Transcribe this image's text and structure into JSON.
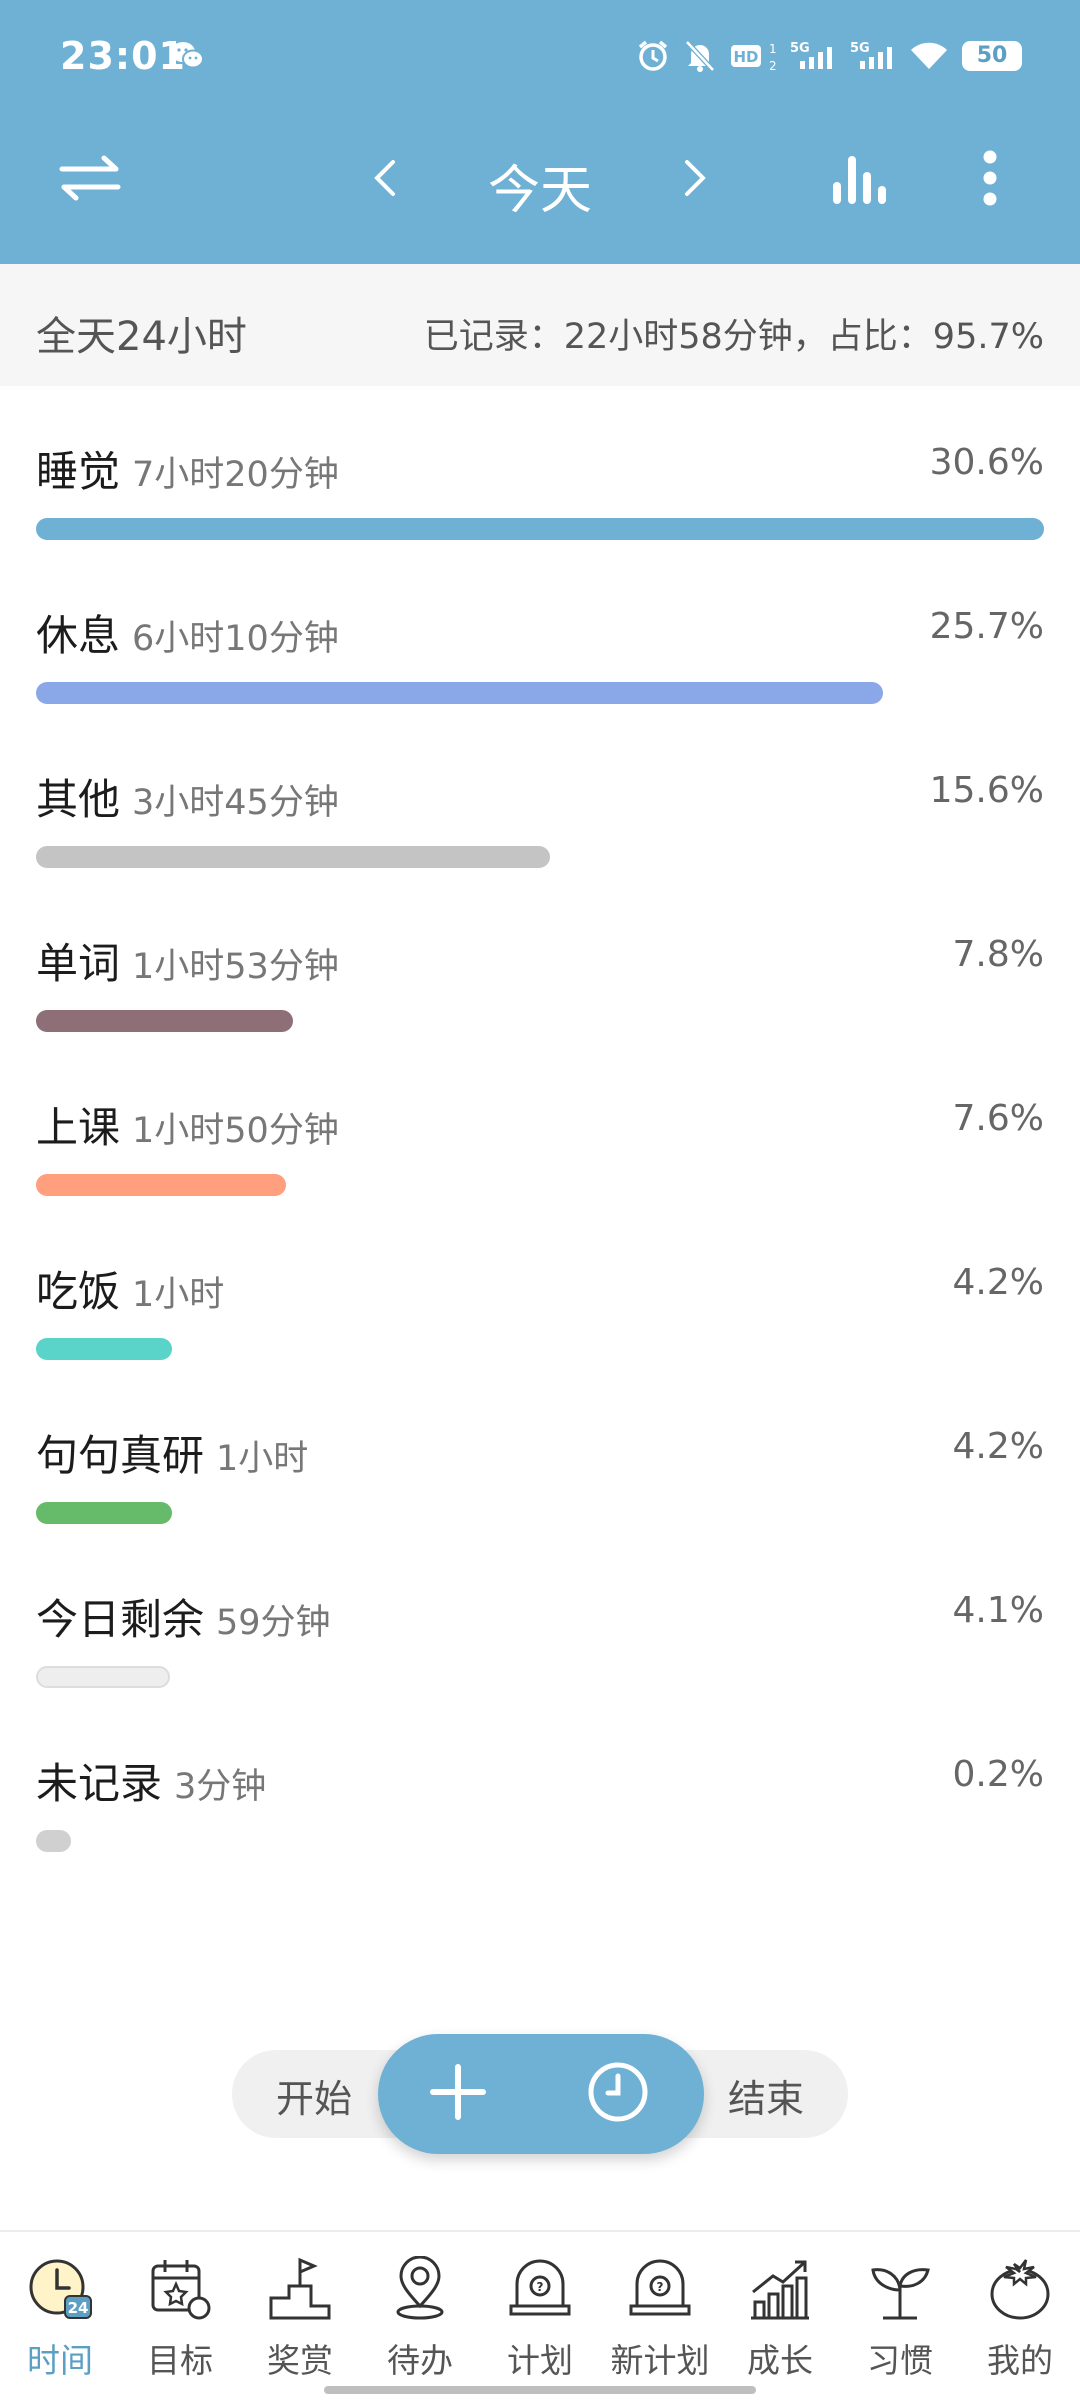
{
  "status_bar": {
    "time": "23:01",
    "icons": [
      "wechat-icon",
      "alarm-icon",
      "bell-off-icon",
      "hd-icon",
      "signal-5g-icon",
      "signal-5g-icon",
      "wifi-icon"
    ],
    "battery": "50"
  },
  "header": {
    "title": "今天",
    "accent_color": "#6fb1d4",
    "icons": [
      "swap-icon",
      "chevron-left-icon",
      "chevron-right-icon",
      "bar-chart-icon",
      "more-vertical-icon"
    ]
  },
  "summary": {
    "total": "全天24小时",
    "recorded": "已记录：22小时58分钟，占比：95.7%"
  },
  "items": [
    {
      "name": "睡觉",
      "duration": "7小时20分钟",
      "percent": "30.6%",
      "fraction": 1.0,
      "color": "#6fb1d4"
    },
    {
      "name": "休息",
      "duration": "6小时10分钟",
      "percent": "25.7%",
      "fraction": 0.84,
      "color": "#8aa8e8"
    },
    {
      "name": "其他",
      "duration": "3小时45分钟",
      "percent": "15.6%",
      "fraction": 0.51,
      "color": "#c4c4c4"
    },
    {
      "name": "单词",
      "duration": "1小时53分钟",
      "percent": "7.8%",
      "fraction": 0.255,
      "color": "#8e6f78"
    },
    {
      "name": "上课",
      "duration": "1小时50分钟",
      "percent": "7.6%",
      "fraction": 0.248,
      "color": "#ff9f7d"
    },
    {
      "name": "吃饭",
      "duration": "1小时",
      "percent": "4.2%",
      "fraction": 0.135,
      "color": "#5ad3c8"
    },
    {
      "name": "句句真研",
      "duration": "1小时",
      "percent": "4.2%",
      "fraction": 0.135,
      "color": "#66bb6a"
    },
    {
      "name": "今日剩余",
      "duration": "59分钟",
      "percent": "4.1%",
      "fraction": 0.133,
      "color": "#eeeeee"
    },
    {
      "name": "未记录",
      "duration": "3分钟",
      "percent": "0.2%",
      "fraction": 0.035,
      "color": "#d0d0d0"
    }
  ],
  "control": {
    "start_label": "开始",
    "end_label": "结束",
    "icons": [
      "plus-icon",
      "clock-icon"
    ]
  },
  "nav": [
    {
      "label": "时间",
      "icon": "clock-24-icon",
      "active": true
    },
    {
      "label": "目标",
      "icon": "calendar-star-icon",
      "active": false
    },
    {
      "label": "奖赏",
      "icon": "podium-flag-icon",
      "active": false
    },
    {
      "label": "待办",
      "icon": "location-pin-icon",
      "active": false
    },
    {
      "label": "计划",
      "icon": "brain-icon",
      "active": false
    },
    {
      "label": "新计划",
      "icon": "brain-icon",
      "active": false
    },
    {
      "label": "成长",
      "icon": "growth-chart-icon",
      "active": false
    },
    {
      "label": "习惯",
      "icon": "sprout-icon",
      "active": false
    },
    {
      "label": "我的",
      "icon": "tomato-icon",
      "active": false
    }
  ]
}
